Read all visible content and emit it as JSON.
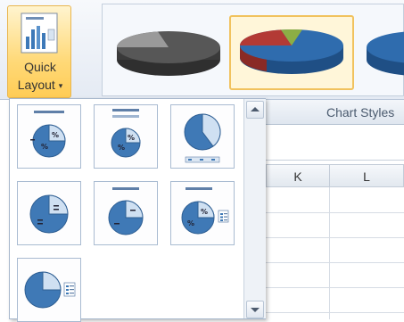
{
  "quick_layout": {
    "line1": "Quick",
    "line2": "Layout",
    "caret": "▾",
    "icon": "quick-layout-chart-icon"
  },
  "chart_styles": {
    "label": "Chart Styles",
    "selected_index": 1,
    "thumbnails": [
      {
        "name": "gray-pie-style",
        "colors": [
          "#4a4a4a",
          "#8c8c8c"
        ]
      },
      {
        "name": "multicolor-pie-style",
        "colors": [
          "#2f6cae",
          "#b33a35",
          "#8cae45"
        ]
      },
      {
        "name": "blue-pie-style",
        "colors": [
          "#2f6cae"
        ]
      }
    ]
  },
  "sheet": {
    "columns": [
      "K",
      "L"
    ]
  },
  "gallery": {
    "layouts": [
      {
        "name": "layout-1",
        "icon": "pie-title-percent-labels-icon"
      },
      {
        "name": "layout-2",
        "icon": "pie-title-subtitle-percent-icon"
      },
      {
        "name": "layout-3",
        "icon": "pie-bottom-legend-icon"
      },
      {
        "name": "layout-4",
        "icon": "pie-data-labels-icon"
      },
      {
        "name": "layout-5",
        "icon": "pie-title-labels-icon"
      },
      {
        "name": "layout-6",
        "icon": "pie-title-percent-legend-icon"
      },
      {
        "name": "layout-7",
        "icon": "pie-right-legend-icon"
      }
    ],
    "scroll_up_icon": "scroll-up-arrow-icon",
    "scroll_down_icon": "scroll-down-arrow-icon"
  },
  "colors": {
    "accent_orange": "#f1c25e",
    "pie_blue": "#3f79b6",
    "pie_light": "#cfe0f2"
  }
}
